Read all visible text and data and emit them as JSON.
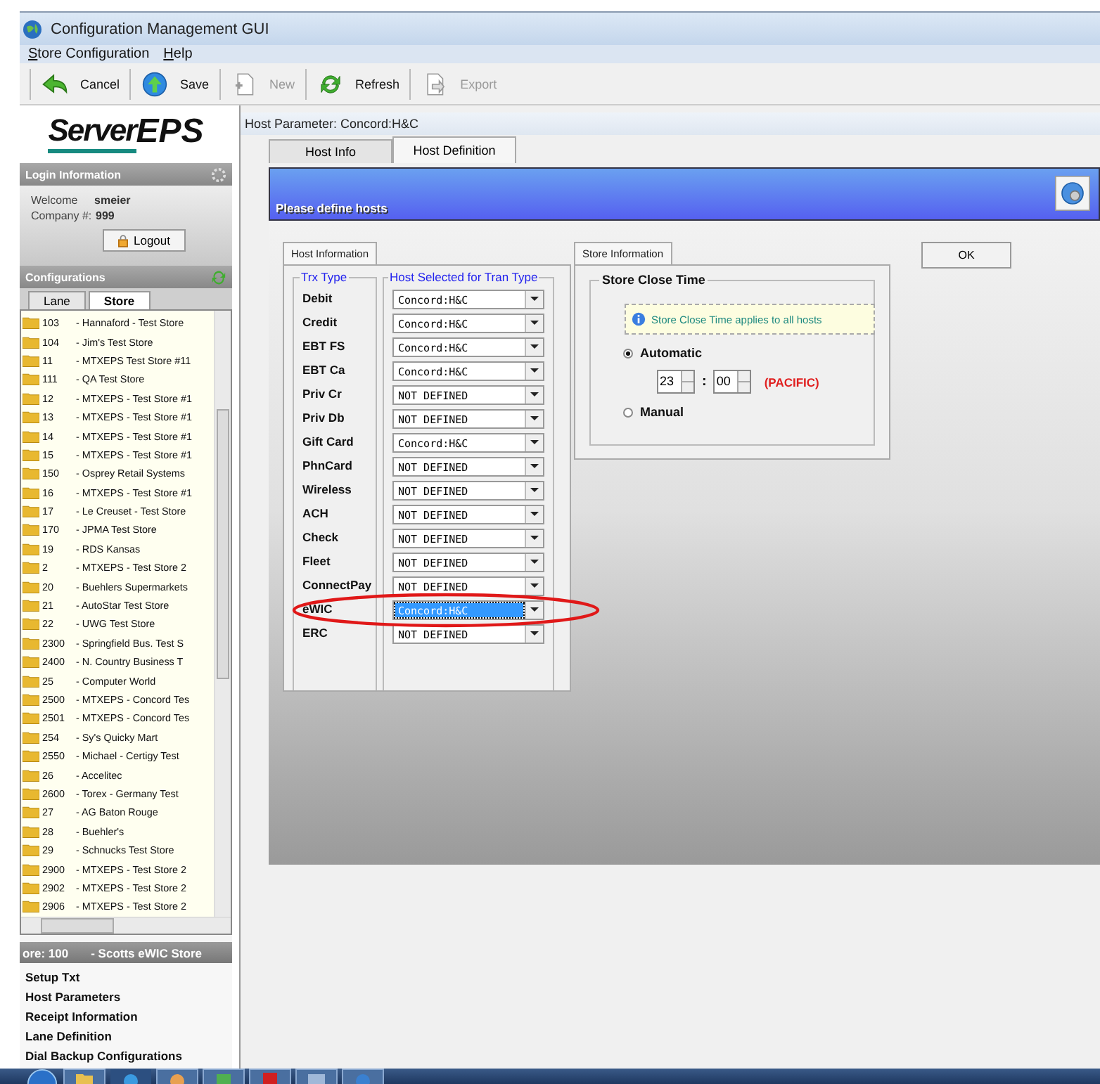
{
  "window": {
    "title": "Configuration Management GUI"
  },
  "menu": [
    {
      "label": "Store Configuration"
    },
    {
      "label": "Help"
    }
  ],
  "toolbar": [
    {
      "label": "Cancel",
      "kind": "cancel",
      "disabled": false
    },
    {
      "label": "Save",
      "kind": "save",
      "disabled": false
    },
    {
      "label": "New",
      "kind": "new",
      "disabled": true
    },
    {
      "label": "Refresh",
      "kind": "refresh",
      "disabled": false
    },
    {
      "label": "Export",
      "kind": "export",
      "disabled": true
    }
  ],
  "sidebar": {
    "logo": {
      "text_1": "Server",
      "text_2": "EPS"
    },
    "login": {
      "title": "Login Information",
      "welcome_label": "Welcome",
      "user": "smeier",
      "company_label": "Company #:",
      "company": "999",
      "logout": "Logout"
    },
    "configurations": {
      "title": "Configurations",
      "tabs": [
        {
          "label": "Lane",
          "selected": false
        },
        {
          "label": "Store",
          "selected": true
        }
      ],
      "items": [
        {
          "code": "103",
          "name": "- Hannaford - Test Store"
        },
        {
          "code": "104",
          "name": "- Jim's Test Store"
        },
        {
          "code": "11",
          "name": "- MTXEPS Test Store #11"
        },
        {
          "code": "111",
          "name": "- QA Test Store"
        },
        {
          "code": "12",
          "name": "- MTXEPS - Test Store #1"
        },
        {
          "code": "13",
          "name": "- MTXEPS - Test Store #1"
        },
        {
          "code": "14",
          "name": "- MTXEPS - Test Store #1"
        },
        {
          "code": "15",
          "name": "- MTXEPS - Test Store #1"
        },
        {
          "code": "150",
          "name": "- Osprey Retail Systems"
        },
        {
          "code": "16",
          "name": "- MTXEPS - Test Store #1"
        },
        {
          "code": "17",
          "name": "- Le Creuset - Test Store"
        },
        {
          "code": "170",
          "name": "- JPMA Test Store"
        },
        {
          "code": "19",
          "name": "- RDS Kansas"
        },
        {
          "code": "2",
          "name": "- MTXEPS - Test Store 2"
        },
        {
          "code": "20",
          "name": "- Buehlers Supermarkets"
        },
        {
          "code": "21",
          "name": "- AutoStar Test Store"
        },
        {
          "code": "22",
          "name": "- UWG Test Store"
        },
        {
          "code": "2300",
          "name": "- Springfield Bus. Test S"
        },
        {
          "code": "2400",
          "name": "- N. Country Business T"
        },
        {
          "code": "25",
          "name": "- Computer World"
        },
        {
          "code": "2500",
          "name": "- MTXEPS - Concord Tes"
        },
        {
          "code": "2501",
          "name": "- MTXEPS - Concord Tes"
        },
        {
          "code": "254",
          "name": "- Sy's Quicky Mart"
        },
        {
          "code": "2550",
          "name": "- Michael - Certigy Test"
        },
        {
          "code": "26",
          "name": "- Accelitec"
        },
        {
          "code": "2600",
          "name": "- Torex - Germany Test"
        },
        {
          "code": "27",
          "name": "- AG Baton Rouge"
        },
        {
          "code": "28",
          "name": "- Buehler's"
        },
        {
          "code": "29",
          "name": "- Schnucks Test Store"
        },
        {
          "code": "2900",
          "name": "- MTXEPS - Test Store 2"
        },
        {
          "code": "2902",
          "name": "- MTXEPS - Test Store 2"
        },
        {
          "code": "2906",
          "name": "- MTXEPS - Test Store 2"
        }
      ]
    },
    "current_store": {
      "code": "ore: 100",
      "name": "- Scotts eWIC Store"
    },
    "links": [
      "Setup Txt",
      "Host Parameters",
      "Receipt Information",
      "Lane Definition",
      "Dial Backup Configurations"
    ]
  },
  "panel": {
    "title": "Host Parameter: Concord:H&C",
    "tabs": [
      {
        "label": "Host Info",
        "selected": false
      },
      {
        "label": "Host Definition",
        "selected": true
      }
    ],
    "banner": "Please define hosts",
    "host_info": {
      "tab": "Host Information",
      "col_1": "Trx Type",
      "col_2": "Host Selected for Tran Type",
      "rows": [
        {
          "trx": "Debit",
          "host": "Concord:H&C",
          "selected": false
        },
        {
          "trx": "Credit",
          "host": "Concord:H&C",
          "selected": false
        },
        {
          "trx": "EBT FS",
          "host": "Concord:H&C",
          "selected": false
        },
        {
          "trx": "EBT Ca",
          "host": "Concord:H&C",
          "selected": false
        },
        {
          "trx": "Priv Cr",
          "host": "NOT DEFINED",
          "selected": false
        },
        {
          "trx": "Priv Db",
          "host": "NOT DEFINED",
          "selected": false
        },
        {
          "trx": "Gift Card",
          "host": "Concord:H&C",
          "selected": false
        },
        {
          "trx": "PhnCard",
          "host": "NOT DEFINED",
          "selected": false
        },
        {
          "trx": "Wireless",
          "host": "NOT DEFINED",
          "selected": false
        },
        {
          "trx": "ACH",
          "host": "NOT DEFINED",
          "selected": false
        },
        {
          "trx": "Check",
          "host": "NOT DEFINED",
          "selected": false
        },
        {
          "trx": "Fleet",
          "host": "NOT DEFINED",
          "selected": false
        },
        {
          "trx": "ConnectPay",
          "host": "NOT DEFINED",
          "selected": false
        },
        {
          "trx": "eWIC",
          "host": "Concord:H&C",
          "selected": true
        },
        {
          "trx": "ERC",
          "host": "NOT DEFINED",
          "selected": false
        }
      ]
    },
    "store_info": {
      "tab": "Store Information",
      "group": "Store Close Time",
      "note": "Store Close Time applies to all hosts",
      "options": [
        {
          "label": "Automatic",
          "selected": true
        },
        {
          "label": "Manual",
          "selected": false
        }
      ],
      "hour": "23",
      "separator": ":",
      "minute": "00",
      "zone": "(PACIFIC)"
    },
    "ok": "OK"
  }
}
